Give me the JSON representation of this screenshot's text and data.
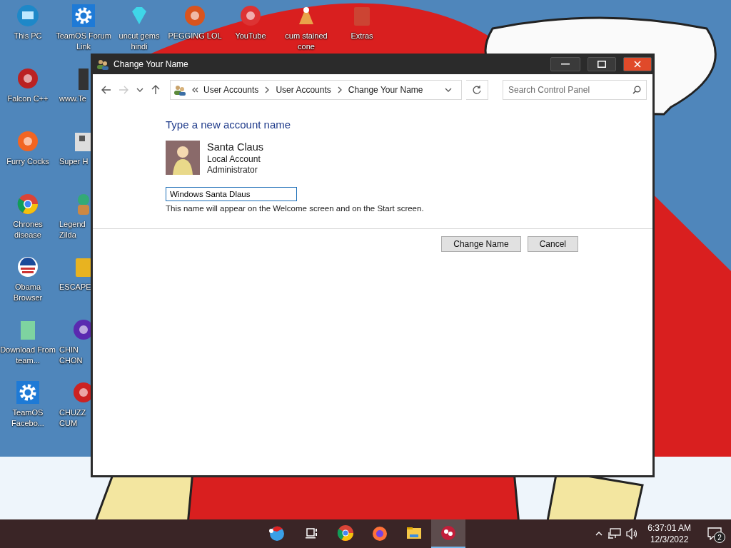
{
  "desktop_icons": [
    {
      "label": "This PC"
    },
    {
      "label": "TeamOS Forum Link"
    },
    {
      "label": "uncut gems hindi"
    },
    {
      "label": "PEGGING LOL"
    },
    {
      "label": "YouTube"
    },
    {
      "label": "cum stained cone"
    },
    {
      "label": "Extras"
    },
    {
      "label": "Falcon C++"
    },
    {
      "label": "www.Te"
    },
    {
      "label": "Furry Cocks"
    },
    {
      "label": "Super H"
    },
    {
      "label": "Chrones disease"
    },
    {
      "label": "Legend Zilda"
    },
    {
      "label": "Obama Browser"
    },
    {
      "label": "ESCAPE"
    },
    {
      "label": "Download From team..."
    },
    {
      "label": "CHIN CHON"
    },
    {
      "label": "TeamOS Facebo..."
    },
    {
      "label": "CHUZZ CUM"
    }
  ],
  "window": {
    "title": "Change Your Name",
    "nav": {
      "back_disabled": false,
      "forward_disabled": true
    },
    "address": {
      "breadcrumbs": [
        "User Accounts",
        "User Accounts",
        "Change Your Name"
      ]
    },
    "search": {
      "placeholder": "Search Control Panel"
    },
    "heading": "Type a new account name",
    "account": {
      "name": "Santa Claus",
      "type": "Local Account",
      "role": "Administrator"
    },
    "name_field": {
      "value": "Windows Santa Dlaus"
    },
    "hint": "This name will appear on the Welcome screen and on the Start screen.",
    "buttons": [
      "Change Name",
      "Cancel"
    ]
  },
  "taskbar": {
    "apps": [
      {
        "active": false
      },
      {
        "active": false
      },
      {
        "active": false
      },
      {
        "active": false
      },
      {
        "active": false
      },
      {
        "active": true
      }
    ],
    "clock": {
      "time": "6:37:01 AM",
      "date": "12/3/2022"
    },
    "notifications": "2"
  }
}
